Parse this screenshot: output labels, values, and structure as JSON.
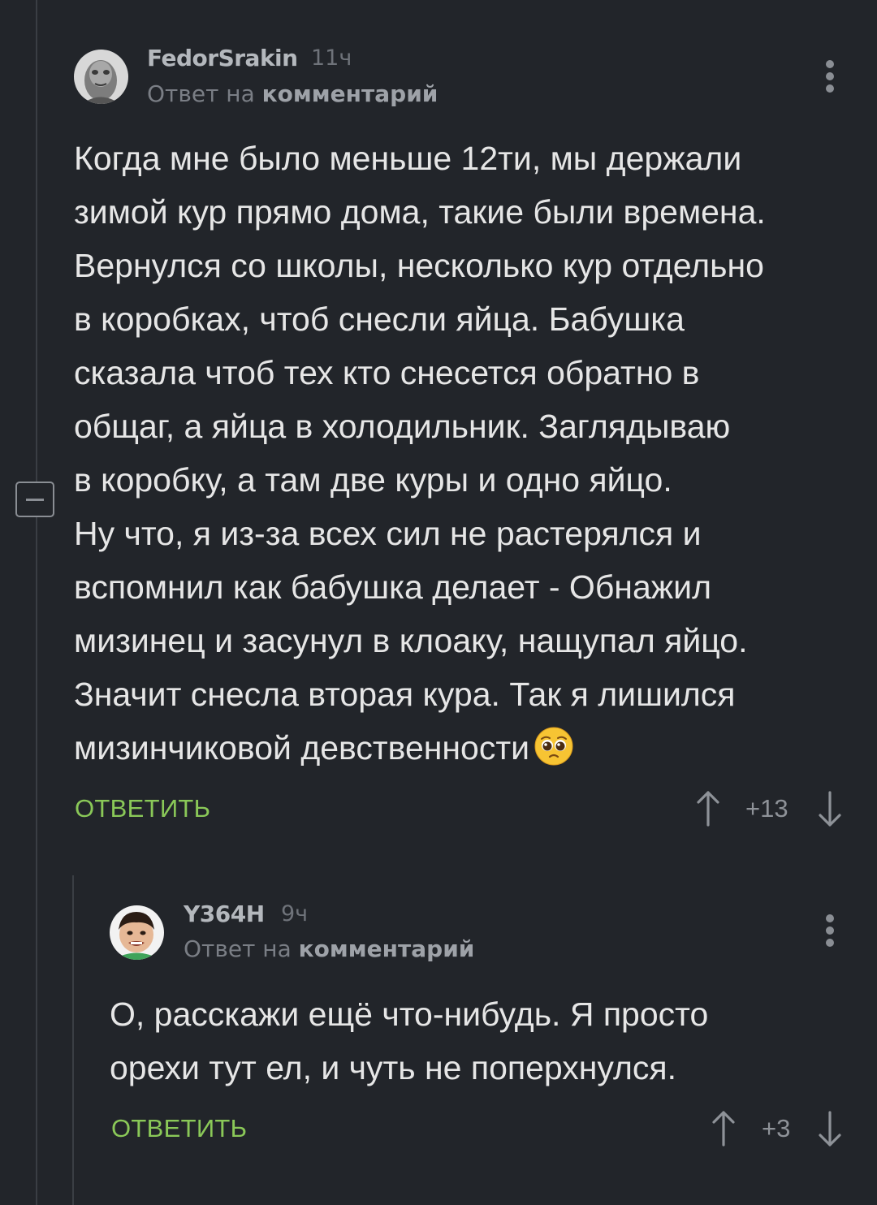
{
  "comment1": {
    "author": "FedorSrakin",
    "time": "11ч",
    "reply_prefix": "Ответ на",
    "reply_target": "комментарий",
    "text_lines": [
      "Когда мне было меньше 12ти, мы держали",
      "зимой кур прямо дома, такие были времена.",
      "Вернулся со школы, несколько кур отдельно",
      "в коробках, чтоб снесли яйца. Бабушка",
      "сказала чтоб тех кто снесется обратно в",
      "общаг, а яйца в холодильник. Заглядываю",
      "в коробку, а там две куры и одно яйцо.",
      "Ну что, я из-за всех сил не растерялся и",
      "вспомнил как бабушка делает - Обнажил",
      "мизинец и засунул в клоаку, нащупал яйцо.",
      "Значит снесла вторая кура. Так я лишился",
      "мизинчиковой девственности"
    ],
    "emoji": "pleading-face",
    "reply_label": "ОТВЕТИТЬ",
    "score": "+13"
  },
  "comment2": {
    "author": "Y364H",
    "time": "9ч",
    "reply_prefix": "Ответ на",
    "reply_target": "комментарий",
    "text_lines": [
      "О, расскажи ещё что-нибудь. Я просто",
      "орехи тут ел, и чуть не поперхнулся."
    ],
    "reply_label": "ОТВЕТИТЬ",
    "score": "+3"
  },
  "colors": {
    "background": "#22252a",
    "accent_green": "#8ac858",
    "author": "#b4b8bd",
    "muted": "#7a7e85"
  }
}
